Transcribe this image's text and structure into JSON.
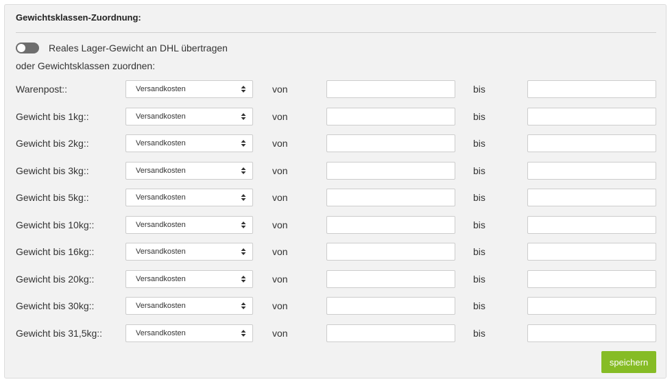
{
  "header": {
    "title": "Gewichtsklassen-Zuordnung:"
  },
  "toggle": {
    "label": "Reales Lager-Gewicht an DHL übertragen",
    "state": "off"
  },
  "subtitle": "oder Gewichtsklassen zuordnen:",
  "common": {
    "from_label": "von",
    "to_label": "bis",
    "select_value": "Versandkosten"
  },
  "rows": [
    {
      "label": "Warenpost::",
      "from_value": "",
      "to_value": ""
    },
    {
      "label": "Gewicht bis 1kg::",
      "from_value": "",
      "to_value": ""
    },
    {
      "label": "Gewicht bis 2kg::",
      "from_value": "",
      "to_value": ""
    },
    {
      "label": "Gewicht bis 3kg::",
      "from_value": "",
      "to_value": ""
    },
    {
      "label": "Gewicht bis 5kg::",
      "from_value": "",
      "to_value": ""
    },
    {
      "label": "Gewicht bis 10kg::",
      "from_value": "",
      "to_value": ""
    },
    {
      "label": "Gewicht bis 16kg::",
      "from_value": "",
      "to_value": ""
    },
    {
      "label": "Gewicht bis 20kg::",
      "from_value": "",
      "to_value": ""
    },
    {
      "label": "Gewicht bis 30kg::",
      "from_value": "",
      "to_value": ""
    },
    {
      "label": "Gewicht bis 31,5kg::",
      "from_value": "",
      "to_value": ""
    }
  ],
  "actions": {
    "save_label": "speichern"
  },
  "colors": {
    "accent": "#86bc25",
    "panel_bg": "#f2f2f2",
    "toggle_off": "#6e6e6e"
  }
}
